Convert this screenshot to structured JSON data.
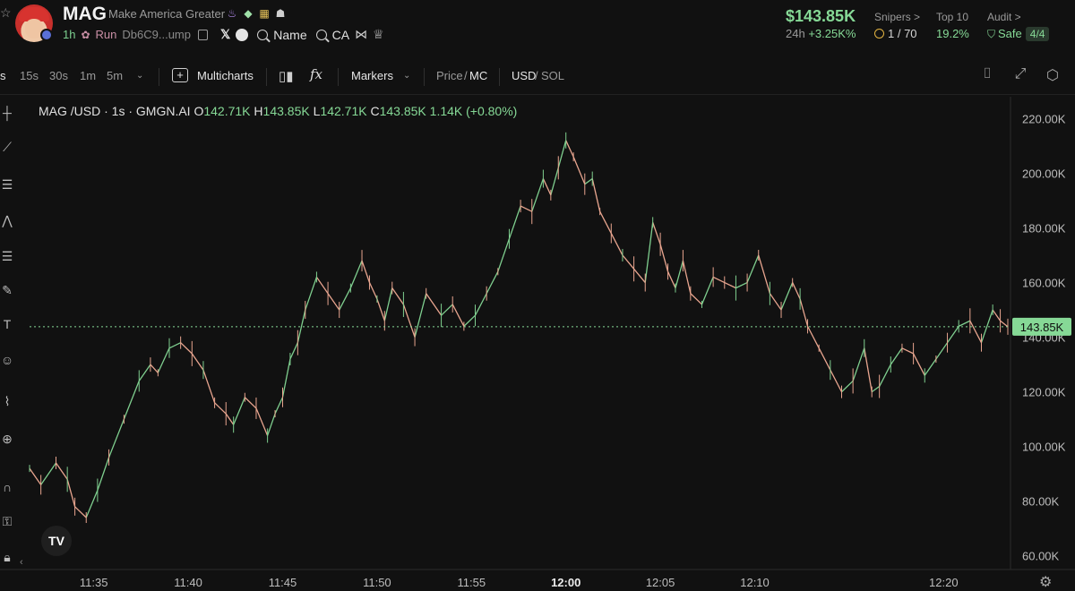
{
  "token": {
    "symbol": "MAG",
    "name": "Make America Greater",
    "age": "1h",
    "run_label": "Run",
    "address": "Db6C9...ump",
    "name_link": "Name",
    "ca_link": "CA"
  },
  "market": {
    "price": "$143.85K",
    "change_label": "24h",
    "change_value": "+3.25K%",
    "snipers_label": "Snipers >",
    "snipers_value": "1 / 70",
    "top10_label": "Top 10",
    "top10_value": "19.2%",
    "audit_label": "Audit >",
    "audit_value": "Safe",
    "audit_badge": "4/4"
  },
  "toolbar": {
    "intervals": [
      "s",
      "15s",
      "30s",
      "1m",
      "5m"
    ],
    "multicharts": "Multicharts",
    "markers": "Markers",
    "price_label": "Price",
    "mc_label": "MC",
    "usd_label": "USD",
    "sol_label": "SOL",
    "slash": "/"
  },
  "legend": {
    "pair": "MAG /USD · 1s · GMGN.AI",
    "o_label": "O",
    "o_value": "142.71K",
    "h_label": "H",
    "h_value": "143.85K",
    "l_label": "L",
    "l_value": "142.71K",
    "c_label": "C",
    "c_value": "143.85K",
    "change": "1.14K (+0.80%)"
  },
  "chart_data": {
    "type": "line",
    "title": "",
    "xlabel": "",
    "ylabel": "",
    "ylim": [
      55,
      228
    ],
    "y_ticks": [
      "220.00K",
      "200.00K",
      "180.00K",
      "160.00K",
      "140.00K",
      "120.00K",
      "100.00K",
      "80.00K",
      "60.00K"
    ],
    "y_tick_values": [
      220,
      200,
      180,
      160,
      140,
      120,
      100,
      80,
      60
    ],
    "x_ticks": [
      "11:35",
      "11:40",
      "11:45",
      "11:50",
      "11:55",
      "12:00",
      "12:05",
      "12:10",
      "12:20"
    ],
    "x_tick_minutes": [
      35,
      40,
      45,
      50,
      55,
      60,
      65,
      70,
      80
    ],
    "x_range_minutes": [
      31.6,
      83.4
    ],
    "last_price_label": "143.85K",
    "last_price": 143.85,
    "series": [
      {
        "x": [
          31.6,
          32.2,
          33.0,
          33.6,
          34.0,
          34.6,
          35.2,
          35.8,
          36.6,
          37.4,
          38.0,
          38.4,
          39.0,
          39.6,
          40.2,
          40.8,
          41.4,
          42.0,
          42.4,
          43.0,
          43.6,
          44.2,
          44.6,
          45.0,
          45.4,
          45.8,
          46.2,
          46.8,
          47.4,
          48.0,
          48.6,
          49.2,
          49.6,
          50.0,
          50.4,
          50.8,
          51.4,
          52.0,
          52.6,
          53.4,
          54.0,
          54.6,
          55.2,
          55.8,
          56.4,
          57.0,
          57.6,
          58.2,
          58.8,
          59.2,
          59.6,
          60.0,
          60.4,
          61.0,
          61.4,
          61.8,
          62.4,
          63.0,
          63.6,
          64.2,
          64.6,
          65.0,
          65.4,
          65.8,
          66.2,
          66.6,
          67.2,
          67.8,
          68.4,
          69.0,
          69.6,
          70.2,
          70.8,
          71.4,
          72.0,
          72.4,
          72.8,
          73.4,
          74.0,
          74.6,
          75.2,
          75.8,
          76.2,
          76.6,
          77.2,
          77.8,
          78.4,
          79.0,
          79.6,
          80.2,
          80.8,
          81.4,
          82.0,
          82.6,
          83.0,
          83.4
        ],
        "y": [
          92,
          86,
          94,
          88,
          78,
          74,
          84,
          96,
          110,
          124,
          130,
          127,
          136,
          138,
          134,
          128,
          116,
          112,
          108,
          118,
          114,
          104,
          112,
          118,
          132,
          138,
          150,
          162,
          156,
          150,
          158,
          168,
          160,
          154,
          146,
          158,
          152,
          140,
          156,
          148,
          152,
          144,
          148,
          156,
          164,
          176,
          188,
          186,
          198,
          192,
          202,
          212,
          206,
          196,
          198,
          186,
          178,
          170,
          165,
          160,
          182,
          174,
          164,
          158,
          168,
          156,
          152,
          162,
          160,
          158,
          160,
          170,
          156,
          150,
          160,
          154,
          144,
          136,
          128,
          120,
          124,
          136,
          120,
          122,
          130,
          136,
          134,
          126,
          132,
          138,
          144,
          146,
          138,
          150,
          146,
          143.85
        ]
      }
    ]
  },
  "tradingview_logo": "TV"
}
